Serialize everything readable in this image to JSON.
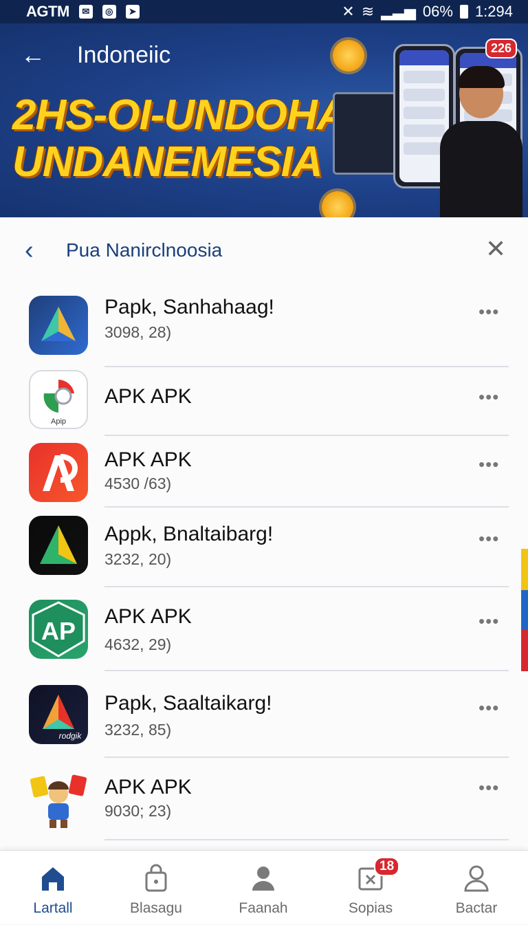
{
  "status_bar": {
    "carrier": "AGTM",
    "icons": [
      "mail-icon",
      "app-icon",
      "nav-icon"
    ],
    "battery": "06%",
    "time": "1:294"
  },
  "hero": {
    "title": "Indoneiic",
    "headline_line1": "2HS-OI-UNDOHAN",
    "headline_line2": "UNDANEMESIA",
    "badge": "226"
  },
  "panel": {
    "title": "Pua Nanirclnoosia"
  },
  "apps": [
    {
      "name": "Papk, Sanhahaag!",
      "sub": "3098, 28)",
      "colors": [
        "#1f3f7a",
        "#2f6bd1"
      ]
    },
    {
      "name": "APK APK",
      "sub": "",
      "icon_label": "Apip",
      "colors": [
        "#ffffff",
        "#ffffff"
      ]
    },
    {
      "name": "APK APK",
      "sub": "4530 /63)",
      "colors": [
        "#e8312b",
        "#f7572c"
      ]
    },
    {
      "name": "Appk, Bnaltaibarg!",
      "sub": "3232, 20)",
      "colors": [
        "#0a0a0a",
        "#111111"
      ]
    },
    {
      "name": "APK APK",
      "sub": "4632, 29)",
      "colors": [
        "#1f8f5d",
        "#2aa36c"
      ]
    },
    {
      "name": "Papk, Saaltaikarg!",
      "sub": "3232, 85)",
      "icon_label": "rodgik",
      "colors": [
        "#0f1226",
        "#1a1e3a"
      ]
    },
    {
      "name": "APK APK",
      "sub": "9030; 23)",
      "colors": [
        "#ffffff",
        "#ffffff"
      ]
    }
  ],
  "nav": [
    {
      "label": "Lartall",
      "icon": "home-icon",
      "active": true
    },
    {
      "label": "Blasagu",
      "icon": "bag-icon",
      "active": false
    },
    {
      "label": "Faanah",
      "icon": "person-icon",
      "active": false
    },
    {
      "label": "Sopias",
      "icon": "close-box-icon",
      "active": false,
      "badge": "18"
    },
    {
      "label": "Bactar",
      "icon": "profile-icon",
      "active": false
    }
  ]
}
